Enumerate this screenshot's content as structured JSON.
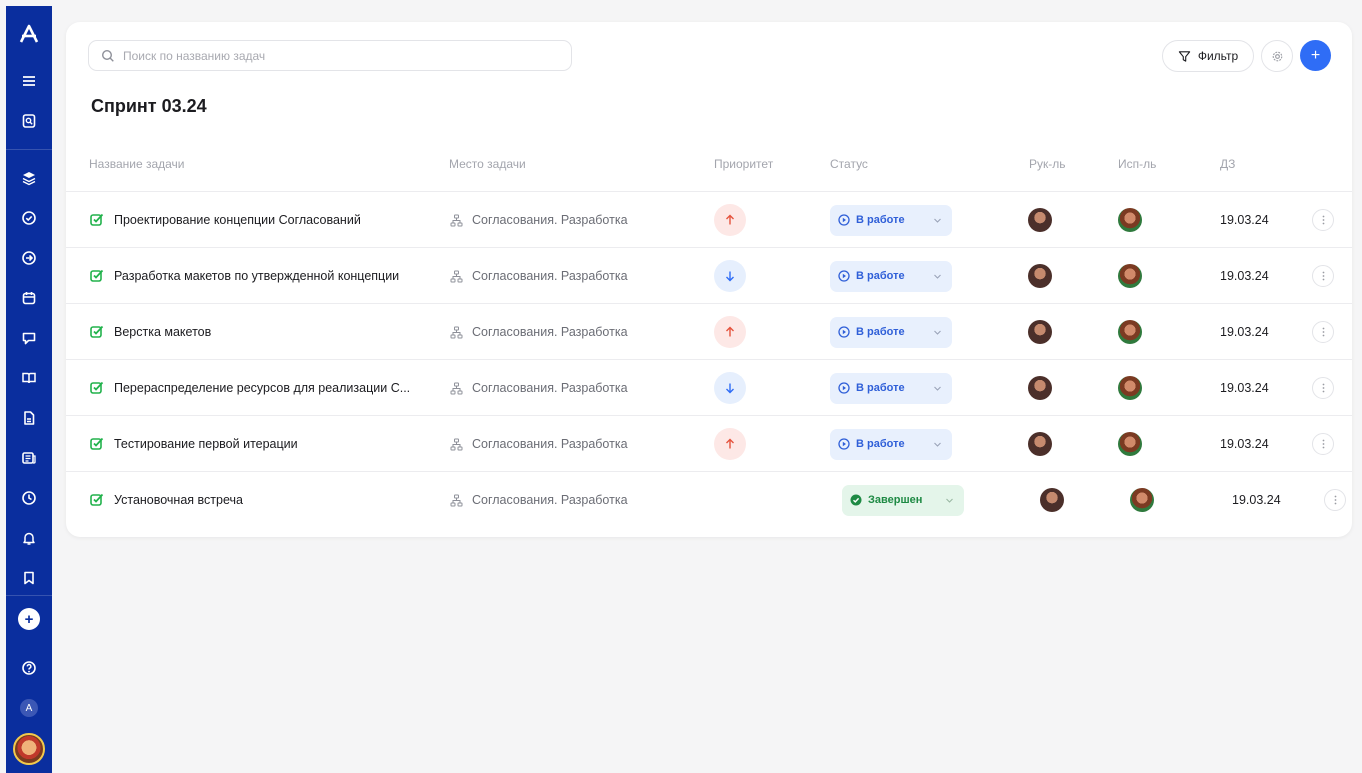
{
  "app": {
    "logo_letter": "A",
    "colors": {
      "sidebar": "#0a2e9e",
      "accent": "#2f6df6",
      "status_work": "#2f5fd8",
      "status_done": "#1e8a44",
      "check": "#22b24c",
      "prio_up": "#e5533d",
      "prio_down": "#2f6df6"
    }
  },
  "sidebar": {
    "top_icons": [
      "menu-icon",
      "search-doc-icon"
    ],
    "icons": [
      "layers-icon",
      "check-circle-icon",
      "arrow-circle-icon",
      "calendar-icon",
      "chat-icon",
      "book-icon",
      "document-icon",
      "news-icon",
      "clock-icon",
      "bell-icon",
      "bookmark-icon"
    ],
    "bottom": {
      "plus": "+",
      "mini_letter": "A"
    }
  },
  "search": {
    "placeholder": "Поиск по названию задач",
    "value": ""
  },
  "toolbar": {
    "filter_label": "Фильтр",
    "add_label": "+"
  },
  "page_title": "Спринт 03.24",
  "columns": {
    "name": "Название задачи",
    "place": "Место задачи",
    "priority": "Приоритет",
    "status": "Статус",
    "lead": "Рук-ль",
    "exec": "Исп-ль",
    "date": "ДЗ"
  },
  "tasks": [
    {
      "name": "Проектирование концепции Согласований",
      "place": "Согласования. Разработка",
      "priority": "up",
      "status": "В работе",
      "status_type": "work",
      "date": "19.03.24"
    },
    {
      "name": "Разработка макетов по утвержденной концепции",
      "place": "Согласования. Разработка",
      "priority": "down",
      "status": "В работе",
      "status_type": "work",
      "date": "19.03.24"
    },
    {
      "name": "Верстка макетов",
      "place": "Согласования. Разработка",
      "priority": "up",
      "status": "В работе",
      "status_type": "work",
      "date": "19.03.24"
    },
    {
      "name": "Перераспределение ресурсов для реализации С...",
      "place": "Согласования. Разработка",
      "priority": "down",
      "status": "В работе",
      "status_type": "work",
      "date": "19.03.24"
    },
    {
      "name": "Тестирование первой итерации",
      "place": "Согласования. Разработка",
      "priority": "up",
      "status": "В работе",
      "status_type": "work",
      "date": "19.03.24"
    },
    {
      "name": "Установочная встреча",
      "place": "Согласования. Разработка",
      "priority": "none",
      "status": "Завершен",
      "status_type": "done",
      "date": "19.03.24"
    }
  ]
}
